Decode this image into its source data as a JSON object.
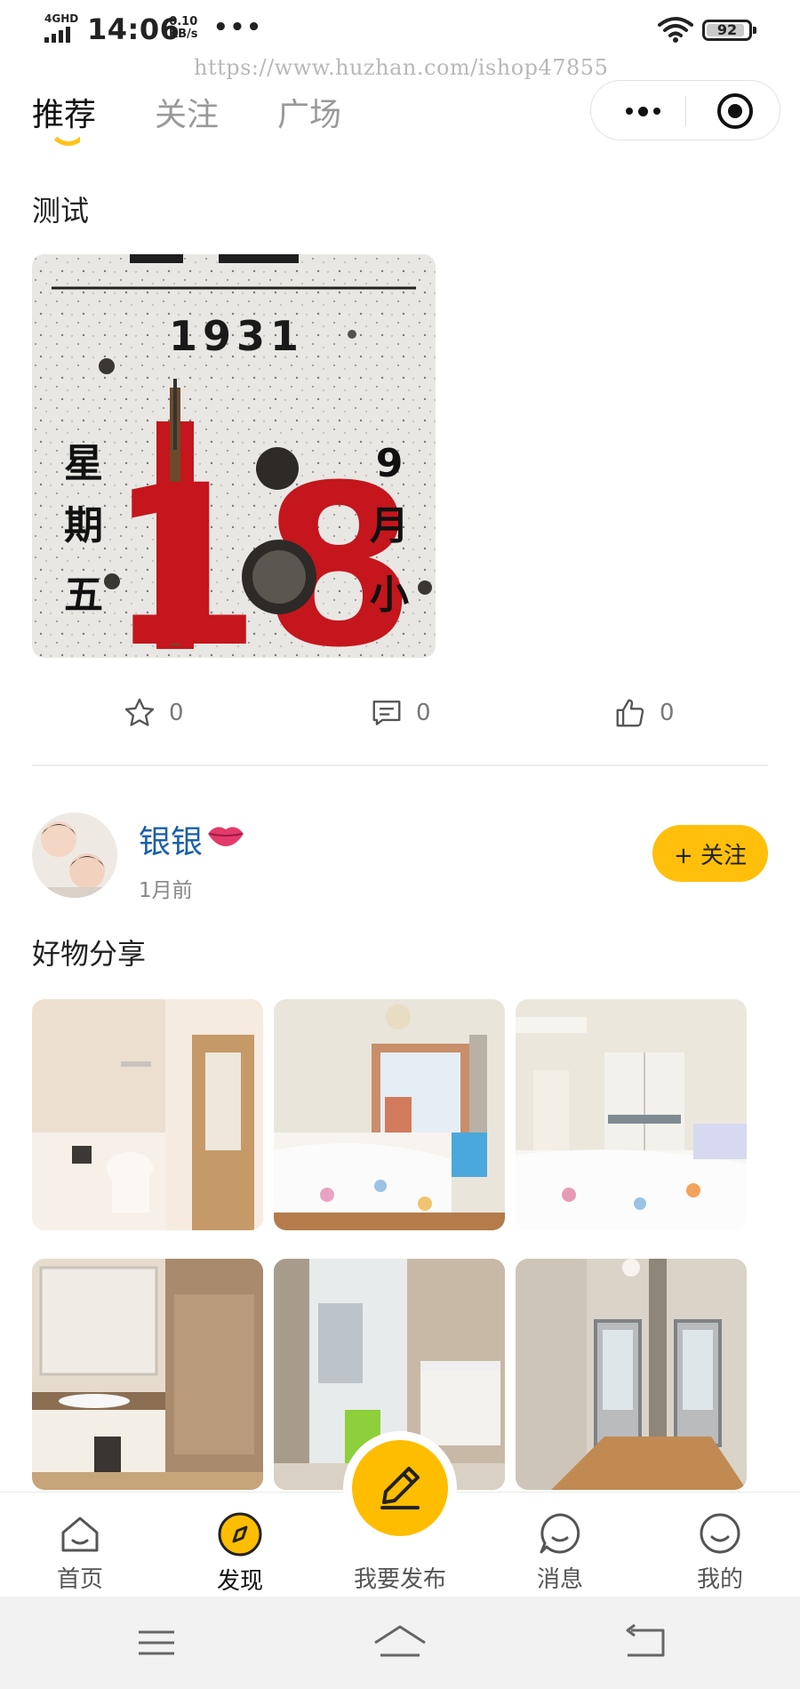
{
  "status_bar": {
    "network": "4GHD",
    "time": "14:06",
    "speed_value": "0.10",
    "speed_unit": "KB/s",
    "overflow_dots": "•••",
    "battery_level": "92"
  },
  "watermark": "https://www.huzhan.com/ishop47855",
  "header": {
    "tabs": [
      {
        "label": "推荐",
        "active": true
      },
      {
        "label": "关注",
        "active": false
      },
      {
        "label": "广场",
        "active": false
      }
    ]
  },
  "post1": {
    "title": "测试",
    "image_text": {
      "year": "1931",
      "day": "18",
      "weekday_chars": [
        "星",
        "期",
        "五"
      ],
      "month_chars": [
        "9",
        "月",
        "小"
      ]
    },
    "favorites": "0",
    "comments": "0",
    "likes": "0"
  },
  "post2": {
    "author": "银银",
    "time": "1月前",
    "follow_label": "+ 关注",
    "title": "好物分享",
    "photos": [
      "bathroom",
      "bedroom-window",
      "bedroom-wardrobe",
      "bathroom-vanity",
      "bathroom-shower",
      "hallway"
    ]
  },
  "tabbar": {
    "items": [
      {
        "label": "首页",
        "icon": "home-icon"
      },
      {
        "label": "发现",
        "icon": "compass-icon",
        "active": true
      },
      {
        "label": "我要发布",
        "icon": "pencil-icon"
      },
      {
        "label": "消息",
        "icon": "message-icon"
      },
      {
        "label": "我的",
        "icon": "profile-smile-icon"
      }
    ]
  },
  "colors": {
    "accent": "#ffbd00",
    "author_name": "#1b5fa8",
    "tab_inactive": "#999999"
  }
}
